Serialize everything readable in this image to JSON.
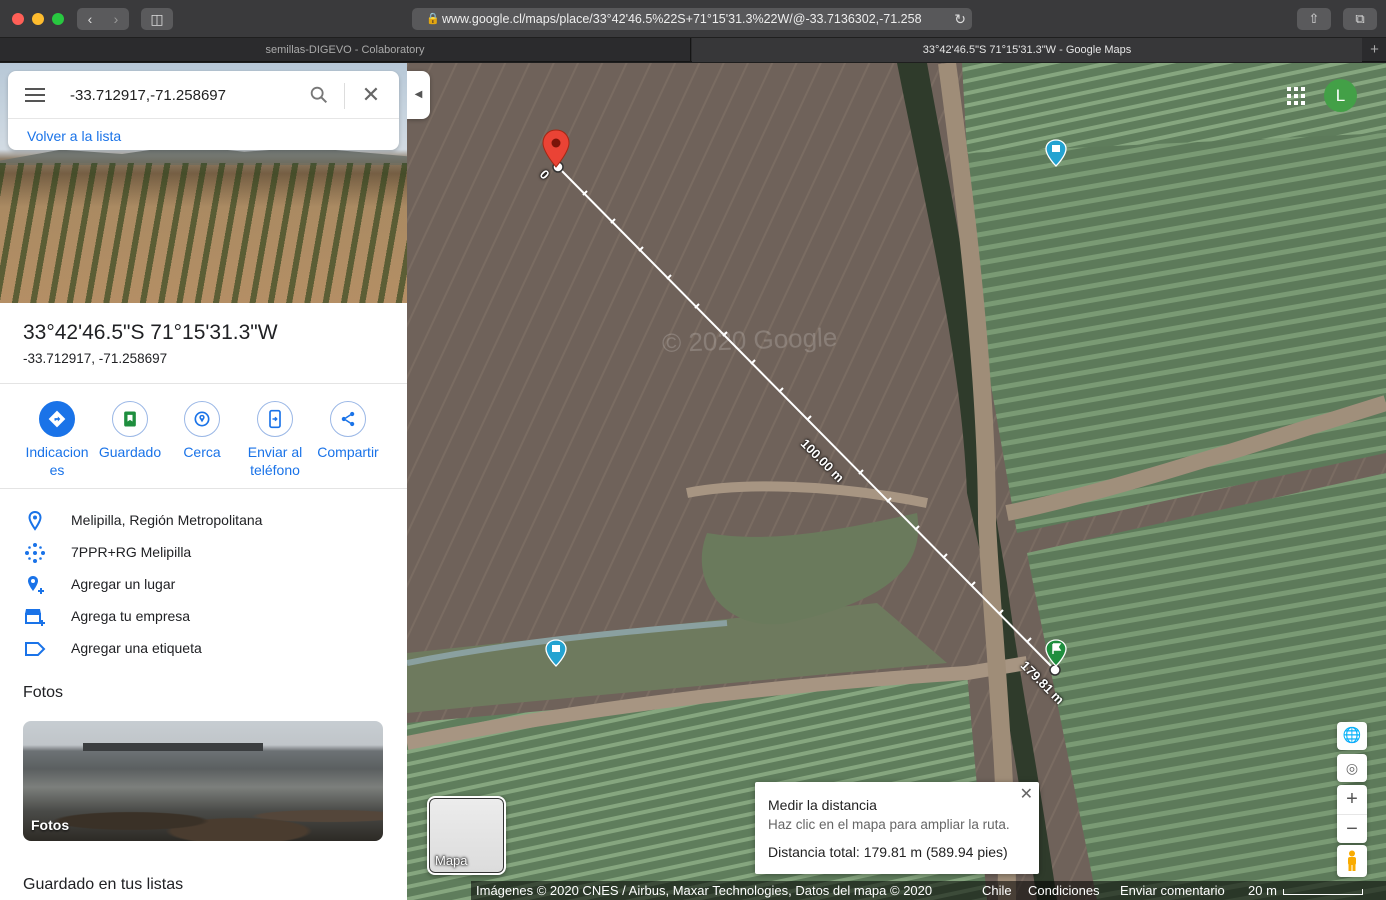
{
  "browser": {
    "url": "www.google.cl/maps/place/33°42'46.5%22S+71°15'31.3%22W/@-33.7136302,-71.258",
    "tabs": [
      {
        "label": "semillas-DIGEVO - Colaboratory"
      },
      {
        "label": "33°42'46.5\"S 71°15'31.3\"W - Google Maps"
      }
    ],
    "tab_plus": "+"
  },
  "search": {
    "value": "-33.712917,-71.258697",
    "back_label": "Volver a la lista"
  },
  "place": {
    "title": "33°42'46.5\"S 71°15'31.3\"W",
    "coords": "-33.712917, -71.258697"
  },
  "actions": [
    {
      "label": "Indicacion es",
      "icon": "directions-icon"
    },
    {
      "label": "Guardado",
      "icon": "bookmark-icon"
    },
    {
      "label": "Cerca",
      "icon": "nearby-icon"
    },
    {
      "label": "Enviar al teléfono",
      "icon": "send-to-phone-icon"
    },
    {
      "label": "Compartir",
      "icon": "share-icon"
    }
  ],
  "info": [
    {
      "text": "Melipilla, Región Metropolitana",
      "icon": "location-pin-icon"
    },
    {
      "text": "7PPR+RG Melipilla",
      "icon": "plus-code-icon"
    },
    {
      "text": "Agregar un lugar",
      "icon": "add-place-icon"
    },
    {
      "text": "Agrega tu empresa",
      "icon": "add-business-icon"
    },
    {
      "text": "Agregar una etiqueta",
      "icon": "label-icon"
    }
  ],
  "photos": {
    "section_title": "Fotos",
    "card_label": "Fotos"
  },
  "saved_section_title": "Guardado en tus listas",
  "map": {
    "watermark": "© 2020 Google",
    "avatar_letter": "L",
    "layer_label": "Mapa",
    "measure_start_label": "0",
    "measure_mid_label": "100.00 m",
    "measure_end_label": "179.81 m",
    "measure": {
      "title": "Medir la distancia",
      "hint": "Haz clic en el mapa para ampliar la ruta.",
      "total": "Distancia total: 179.81 m (589.94 pies)"
    },
    "attribution": {
      "imagery": "Imágenes © 2020 CNES / Airbus, Maxar Technologies, Datos del mapa © 2020",
      "country": "Chile",
      "terms": "Condiciones",
      "feedback": "Enviar comentario",
      "scale": "20 m"
    },
    "colors": {
      "pin_red": "#ea4335",
      "pin_teal": "#24a3d1",
      "pin_green": "#1e8e3e",
      "accent_blue": "#1a73e8"
    }
  }
}
